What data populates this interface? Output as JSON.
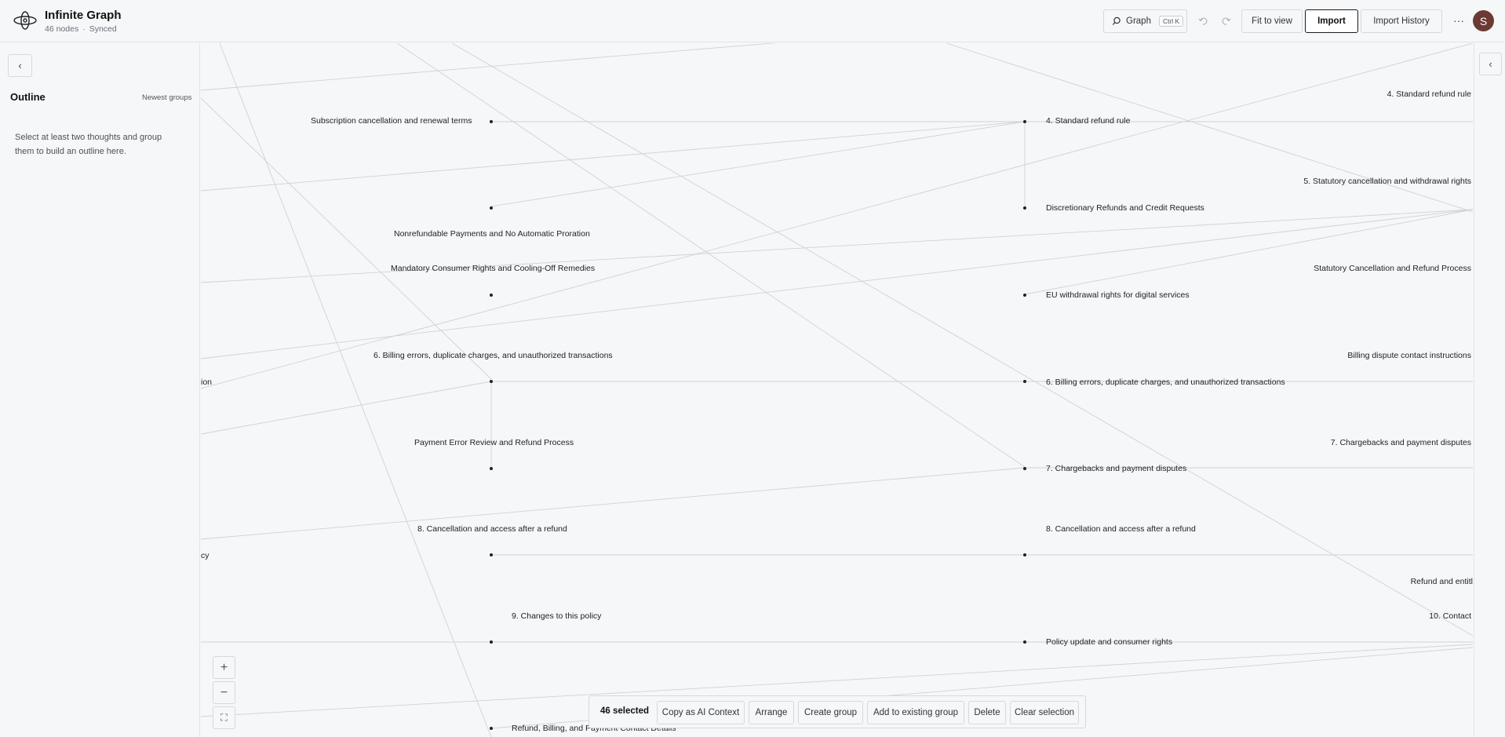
{
  "app": {
    "title": "Infinite Graph",
    "node_count": "46 nodes",
    "sync_status": "Synced",
    "separator": "·"
  },
  "toolbar": {
    "search_label": "Graph",
    "search_shortcut": "Ctrl K",
    "undo_icon": "undo-icon",
    "redo_icon": "redo-icon",
    "fit_label": "Fit to view",
    "import_label": "Import",
    "history_label": "Import History",
    "more_label": "···",
    "avatar_initial": "S"
  },
  "sidebar": {
    "collapse_glyph": "‹",
    "title": "Outline",
    "newest_label": "Newest groups",
    "hint": "Select at least two thoughts and group them to build an outline here."
  },
  "right_rail": {
    "collapse_glyph": "‹"
  },
  "nodes": {
    "n1": "Subscription cancellation and renewal terms",
    "n2": "4. Standard refund rule",
    "n3": "4. Standard refund rule",
    "n4": "5. Statutory cancellation and withdrawal rights",
    "n5": "Discretionary Refunds and Credit Requests",
    "n6": "Nonrefundable Payments and No Automatic Proration",
    "n7": "Mandatory Consumer Rights and Cooling-Off Remedies",
    "n8": "Statutory Cancellation and Refund Process",
    "n9": "EU withdrawal rights for digital services",
    "n10": "6. Billing errors, duplicate charges, and unauthorized transactions",
    "n11": "Billing dispute contact instructions",
    "n12": "ion",
    "n13": "6. Billing errors, duplicate charges, and unauthorized transactions",
    "n14": "Payment Error Review and Refund Process",
    "n15": "7. Chargebacks and payment disputes",
    "n16": "7. Chargebacks and payment disputes",
    "n17": "8. Cancellation and access after a refund",
    "n18": "8. Cancellation and access after a refund",
    "n19": "cy",
    "n20": "Refund and entitl",
    "n21": "9. Changes to this policy",
    "n22": "10. Contact",
    "n23": "Policy update and consumer rights",
    "n24": "Refund, Billing, and Payment Contact Details"
  },
  "zoom": {
    "in": "+",
    "out": "−",
    "fullscreen": "⛶"
  },
  "selection": {
    "count": "46 selected",
    "copy": "Copy as AI Context",
    "arrange": "Arrange",
    "create_group": "Create group",
    "add_existing": "Add to existing group",
    "delete": "Delete",
    "clear": "Clear selection"
  }
}
